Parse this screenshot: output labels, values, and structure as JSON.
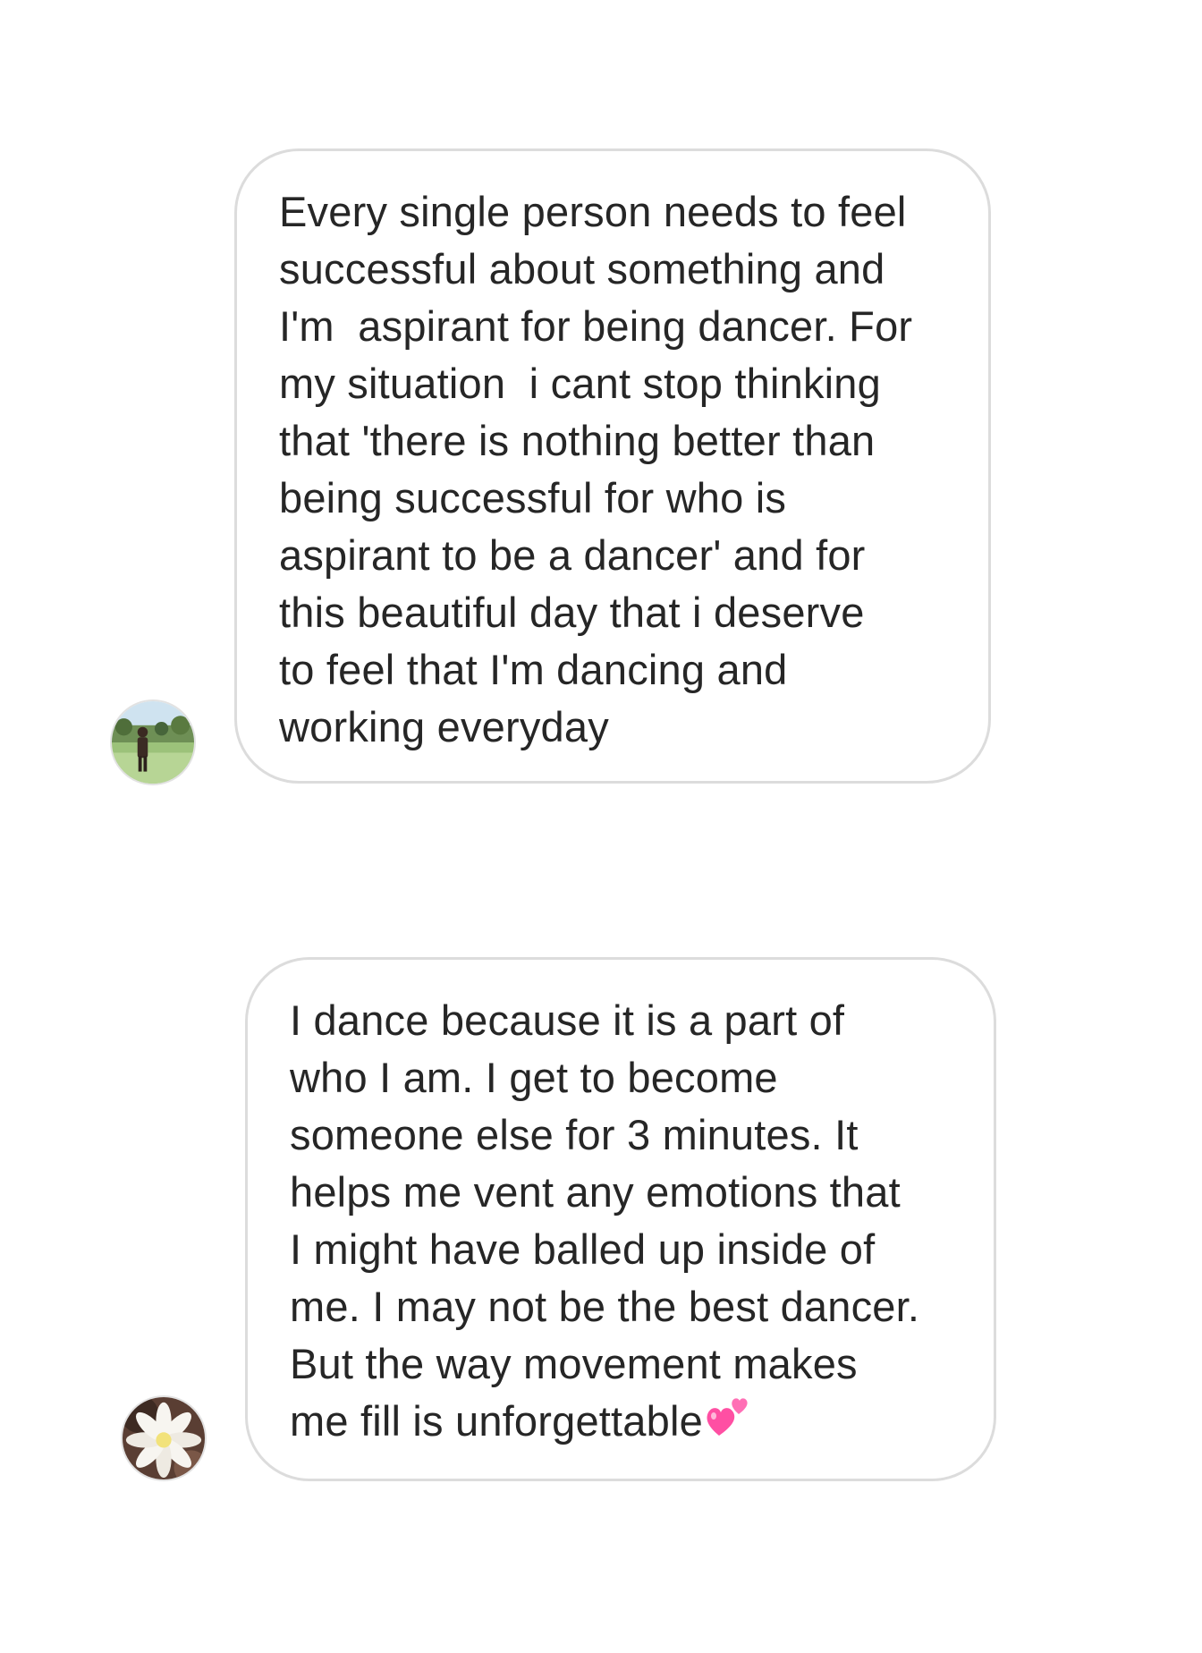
{
  "messages": [
    {
      "lines": [
        "Every single person needs to feel",
        "successful about something and",
        "I'm  aspirant for being dancer. For",
        "my situation  i cant stop thinking",
        "that 'there is nothing better than",
        "being successful for who is",
        "aspirant to be a dancer' and for",
        "this beautiful day that i deserve",
        "to feel that I'm dancing and",
        "working everyday"
      ],
      "avatar_icon": "person-in-park-photo-icon"
    },
    {
      "lines": [
        "I dance because it is a part of",
        "who I am. I get to become",
        "someone else for 3 minutes. It",
        "helps me vent any emotions that",
        "I might have balled up inside of",
        "me. I may not be the best dancer.",
        "But the way movement makes",
        "me fill is unforgettable"
      ],
      "trailing_emoji": "two-hearts-emoji",
      "avatar_icon": "white-flower-photo-icon"
    }
  ],
  "colors": {
    "text": "#262626",
    "bubble_border": "#dcdcdc",
    "background": "#ffffff",
    "heart": "#ff4fa3"
  }
}
